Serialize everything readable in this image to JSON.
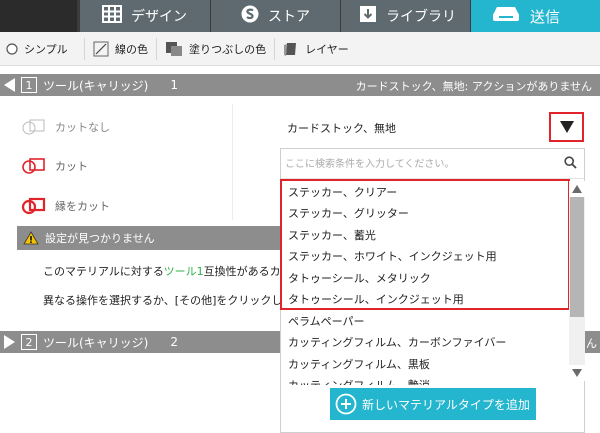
{
  "tabs": [
    {
      "label": "デザイン",
      "icon": "grid-icon"
    },
    {
      "label": "ストア",
      "icon": "silhouette-s-icon"
    },
    {
      "label": "ライブラリ",
      "icon": "download-icon"
    },
    {
      "label": "送信",
      "icon": "cutter-icon",
      "active": true
    }
  ],
  "toolbar": {
    "simple": "シンプル",
    "line_color": "線の色",
    "fill_color": "塗りつぶしの色",
    "layer": "レイヤー"
  },
  "section1": {
    "number": "1",
    "title": "ツール(キャリッジ)",
    "count": "1",
    "status": "カードストック、無地: アクションがありません"
  },
  "section2": {
    "number": "2",
    "title": "ツール(キャリッジ)",
    "count": "2",
    "peek": "ん"
  },
  "actions": {
    "none": "カットなし",
    "cut": "カット",
    "edge": "縁をカット"
  },
  "warning": {
    "title": "設定が見つかりません",
    "line1_a": "このマテリアルに対する",
    "line1_b": "ツール1",
    "line1_c": "互換性があるカット",
    "line2": "異なる操作を選択するか、[その他]をクリックして"
  },
  "material": {
    "selected": "カードストック、無地",
    "search_placeholder": "ここに検索条件を入力してください。",
    "items": [
      "ステッカー、クリアー",
      "ステッカー、グリッター",
      "ステッカー、蓄光",
      "ステッカー、ホワイト、インクジェット用",
      "タトゥーシール、メタリック",
      "タトゥーシール、インクジェット用",
      "ペラムペーパー",
      "カッティングフィルム、カーボンファイバー",
      "カッティングフィルム、黒板",
      "カッティングフィルム、艶消"
    ],
    "add_label": "新しいマテリアルタイプを追加"
  },
  "colors": {
    "accent": "#25b6cf",
    "highlight": "#e1242a",
    "header": "#8d8d8d"
  }
}
